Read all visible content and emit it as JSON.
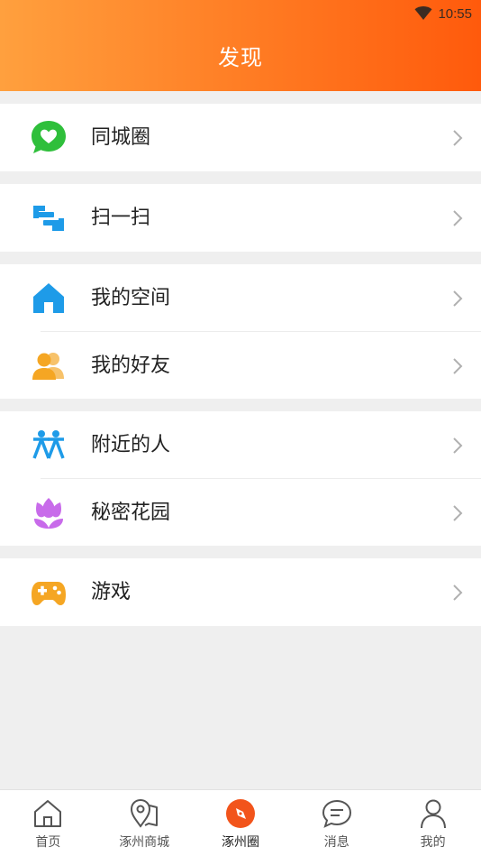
{
  "status_bar": {
    "time": "10:55",
    "wifi_icon": "wifi-icon"
  },
  "header": {
    "title": "发现",
    "gradient": [
      "#ffa03e",
      "#ff5a0c"
    ]
  },
  "menu": {
    "groups": [
      {
        "items": [
          {
            "label": "同城圈",
            "icon": "chat-heart-icon",
            "color": "#2fbf3b"
          }
        ]
      },
      {
        "items": [
          {
            "label": "扫一扫",
            "icon": "scan-icon",
            "color": "#1e9be8"
          }
        ]
      },
      {
        "items": [
          {
            "label": "我的空间",
            "icon": "home-icon",
            "color": "#1e9be8"
          },
          {
            "label": "我的好友",
            "icon": "friends-icon",
            "color": "#f5a623"
          }
        ]
      },
      {
        "items": [
          {
            "label": "附近的人",
            "icon": "nearby-people-icon",
            "color": "#1e9be8"
          },
          {
            "label": "秘密花园",
            "icon": "tulip-icon",
            "color": "#c86bea"
          }
        ]
      },
      {
        "items": [
          {
            "label": "游戏",
            "icon": "gamepad-icon",
            "color": "#f5a623"
          }
        ]
      }
    ]
  },
  "tabbar": {
    "tabs": [
      {
        "label": "首页",
        "icon": "home-outline-icon"
      },
      {
        "label": "涿州商城",
        "icon": "map-pin-icon"
      },
      {
        "label": "涿州圈",
        "icon": "compass-icon",
        "active": true,
        "accent": "#f2541b"
      },
      {
        "label": "消息",
        "icon": "message-icon"
      },
      {
        "label": "我的",
        "icon": "person-icon"
      }
    ]
  }
}
